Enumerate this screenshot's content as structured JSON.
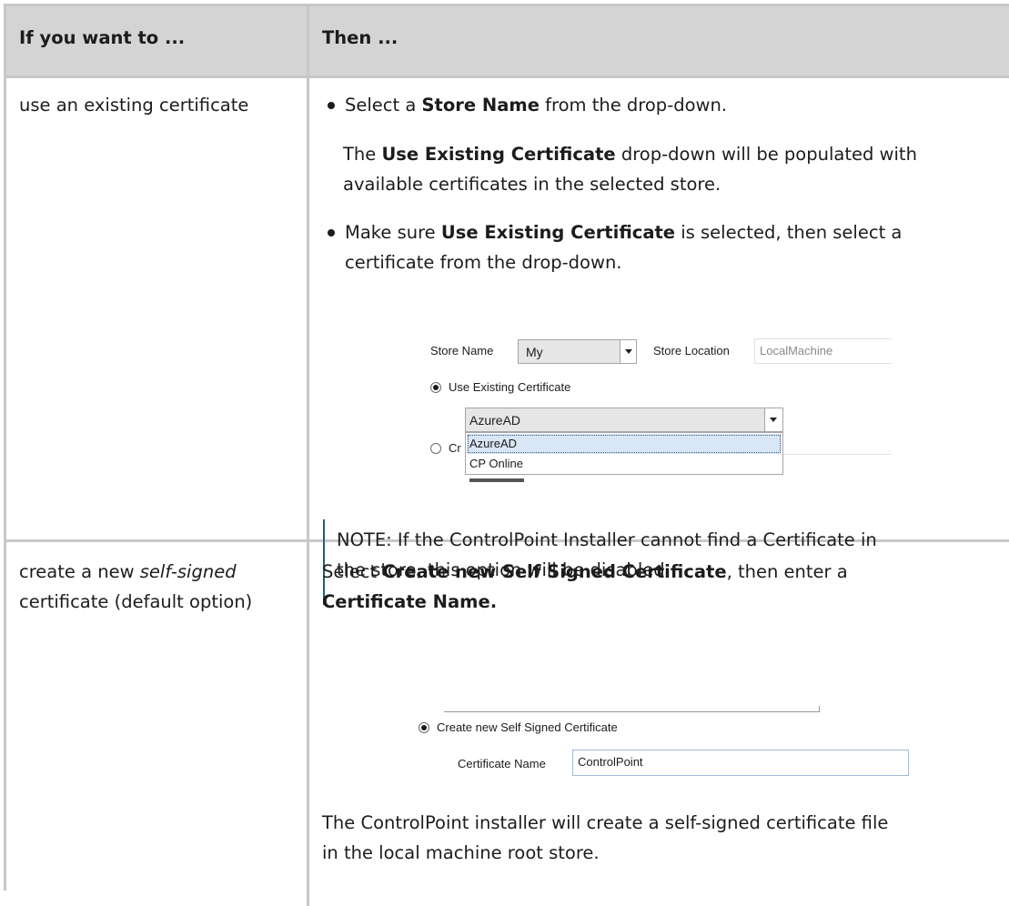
{
  "table": {
    "header": {
      "col1": "If you want to ...",
      "col2": "Then ..."
    },
    "row1": {
      "condition": "use an existing certificate",
      "bullet1": {
        "pre": "Select a ",
        "bold": "Store Name",
        "post": " from the drop-down."
      },
      "para": {
        "pre": "The ",
        "bold": "Use Existing Certificate",
        "post_line1": " drop-down will be populated with",
        "line2": "available certificates in the selected store."
      },
      "bullet2": {
        "pre": "Make sure ",
        "bold": "Use Existing Certificate",
        "post_line1": " is selected, then select a",
        "line2": "certificate from the drop-down."
      },
      "screenshot": {
        "store_name_label": "Store Name",
        "store_name_value": "My",
        "store_location_label": "Store Location",
        "store_location_value": "LocalMachine",
        "use_existing_label": "Use Existing Certificate",
        "cert_selected": "AzureAD",
        "dropdown_options": [
          "AzureAD",
          "CP Online"
        ],
        "create_prefix": "Cr"
      },
      "note_line1": "NOTE:  If the ControlPoint Installer cannot find a Certificate in",
      "note_line2": "the store, this option will be disabled."
    },
    "row2": {
      "condition_line1_pre": "create a new ",
      "condition_line1_italic": "self-signed",
      "condition_line2": "certificate (default option)",
      "instr_pre": "Select ",
      "instr_bold": "Create new Self Signed Certificate",
      "instr_post": ", then enter a",
      "instr_line2_bold": "Certificate Name.",
      "screenshot": {
        "create_new_label": "Create new Self Signed Certificate",
        "cert_name_label": "Certificate Name",
        "cert_name_value": "ControlPoint"
      },
      "result_line1": "The ControlPoint installer will create a self-signed certificate file",
      "result_line2": "in the local machine root store."
    }
  }
}
